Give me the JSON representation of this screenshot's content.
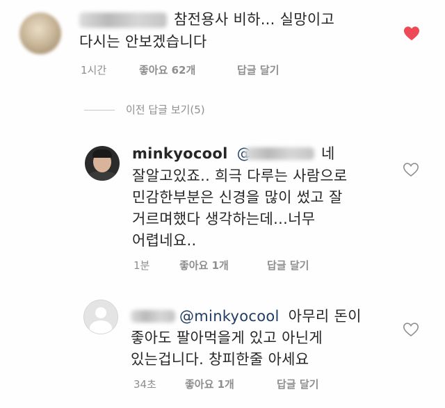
{
  "comments": [
    {
      "username_visible": false,
      "text_line1": "참전용사 비하... 실망이고",
      "text_line2": "다시는 안보겠습니다",
      "time": "1시간",
      "likes": "좋아요 62개",
      "reply": "답글 달기",
      "liked": true,
      "avatar": "blurred-avatar",
      "like_color": "#ed4956"
    },
    {
      "username": "minkyocool",
      "mention": "@",
      "text_line1_end": "네",
      "text_line2": "잘알고있죠.. 희극 다루는 사람으로",
      "text_line3": "민감한부분은 신경을 많이 썼고 잘",
      "text_line4": "거르며했다 생각하는데...너무",
      "text_line5": "어렵네요..",
      "time": "1분",
      "likes": "좋아요 1개",
      "reply": "답글 달기",
      "liked": false,
      "avatar": "profile-photo-avatar"
    },
    {
      "username_visible": false,
      "mention": "@minkyocool",
      "text_line1_end": "아무리 돈이",
      "text_line2": "좋아도 팔아먹을게 있고 아닌게",
      "text_line3": "있는겁니다. 창피한줄 아세요",
      "time": "34초",
      "likes": "좋아요 1개",
      "reply": "답글 달기",
      "liked": false,
      "avatar": "default-avatar"
    }
  ],
  "view_previous_replies": "이전 답글 보기(5)",
  "icons": {
    "like_filled": "heart-filled-icon",
    "like_outline": "heart-outline-icon"
  }
}
